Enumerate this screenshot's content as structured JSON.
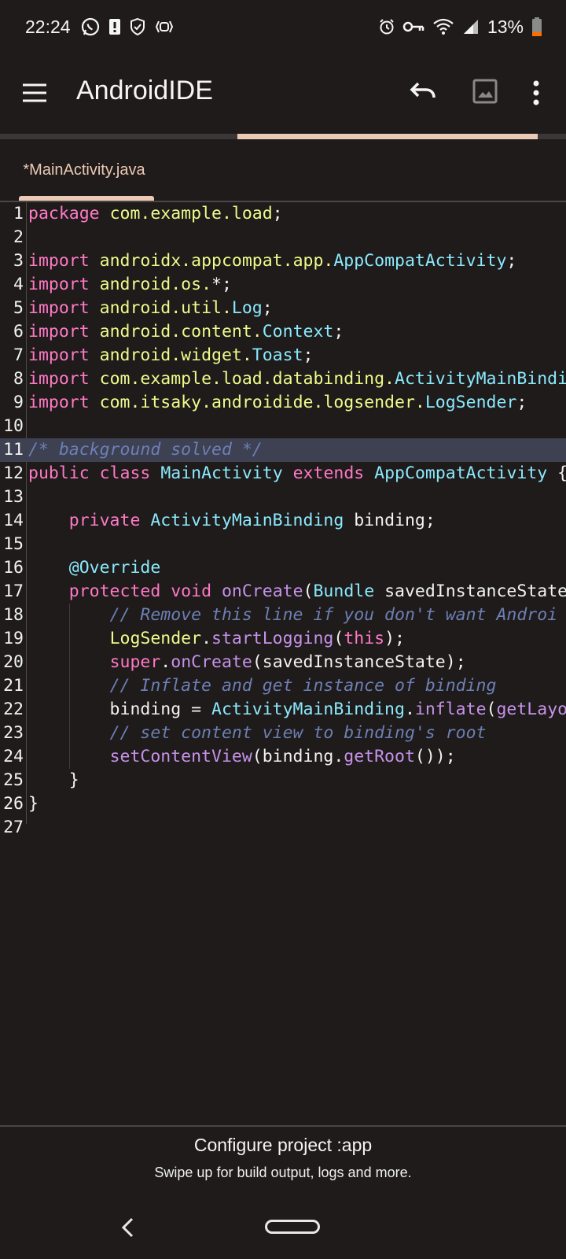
{
  "status": {
    "time": "22:24",
    "battery": "13%",
    "left_icons": [
      "whatsapp-icon",
      "alert-icon",
      "shield-icon",
      "debug-icon"
    ],
    "right_icons": [
      "alarm-icon",
      "vpn-key-icon",
      "wifi-icon",
      "signal-icon",
      "battery-icon"
    ]
  },
  "appbar": {
    "title": "AndroidIDE",
    "icons": [
      "menu-icon",
      "undo-icon",
      "image-icon",
      "more-vert-icon"
    ]
  },
  "progress": 0.55,
  "tabs": [
    {
      "label": "*MainActivity.java",
      "active": true
    }
  ],
  "editor": {
    "current_line": 11,
    "lines": [
      {
        "n": "1",
        "tokens": [
          [
            "kw",
            "package"
          ],
          [
            "",
            " "
          ],
          [
            "pk",
            "com.example.load"
          ],
          [
            "",
            ";"
          ]
        ]
      },
      {
        "n": "2",
        "tokens": []
      },
      {
        "n": "3",
        "tokens": [
          [
            "kw",
            "import"
          ],
          [
            "",
            " "
          ],
          [
            "pk",
            "androidx.appcompat.app."
          ],
          [
            "ty",
            "AppCompatActivity"
          ],
          [
            "",
            ";"
          ]
        ]
      },
      {
        "n": "4",
        "tokens": [
          [
            "kw",
            "import"
          ],
          [
            "",
            " "
          ],
          [
            "pk",
            "android.os."
          ],
          [
            "",
            "*;"
          ]
        ]
      },
      {
        "n": "5",
        "tokens": [
          [
            "kw",
            "import"
          ],
          [
            "",
            " "
          ],
          [
            "pk",
            "android.util."
          ],
          [
            "ty",
            "Log"
          ],
          [
            "",
            ";"
          ]
        ]
      },
      {
        "n": "6",
        "tokens": [
          [
            "kw",
            "import"
          ],
          [
            "",
            " "
          ],
          [
            "pk",
            "android.content."
          ],
          [
            "ty",
            "Context"
          ],
          [
            "",
            ";"
          ]
        ]
      },
      {
        "n": "7",
        "tokens": [
          [
            "kw",
            "import"
          ],
          [
            "",
            " "
          ],
          [
            "pk",
            "android.widget."
          ],
          [
            "ty",
            "Toast"
          ],
          [
            "",
            ";"
          ]
        ]
      },
      {
        "n": "8",
        "tokens": [
          [
            "kw",
            "import"
          ],
          [
            "",
            " "
          ],
          [
            "pk",
            "com.example.load.databinding."
          ],
          [
            "ty",
            "ActivityMainBindi"
          ]
        ]
      },
      {
        "n": "9",
        "tokens": [
          [
            "kw",
            "import"
          ],
          [
            "",
            " "
          ],
          [
            "pk",
            "com.itsaky.androidide.logsender."
          ],
          [
            "ty",
            "LogSender"
          ],
          [
            "",
            ";"
          ]
        ]
      },
      {
        "n": "10",
        "tokens": []
      },
      {
        "n": "11",
        "tokens": [
          [
            "cm",
            "/* background solved */"
          ]
        ]
      },
      {
        "n": "12",
        "tokens": [
          [
            "kw",
            "public"
          ],
          [
            "",
            " "
          ],
          [
            "kw",
            "class"
          ],
          [
            "",
            " "
          ],
          [
            "ty",
            "MainActivity"
          ],
          [
            "",
            " "
          ],
          [
            "kw",
            "extends"
          ],
          [
            "",
            " "
          ],
          [
            "ty",
            "AppCompatActivity"
          ],
          [
            "",
            " {"
          ]
        ]
      },
      {
        "n": "13",
        "tokens": []
      },
      {
        "n": "14",
        "tokens": [
          [
            "",
            "    "
          ],
          [
            "kw",
            "private"
          ],
          [
            "",
            " "
          ],
          [
            "ty",
            "ActivityMainBinding"
          ],
          [
            "",
            " binding;"
          ]
        ]
      },
      {
        "n": "15",
        "tokens": []
      },
      {
        "n": "16",
        "tokens": [
          [
            "",
            "    "
          ],
          [
            "ty",
            "@Override"
          ]
        ]
      },
      {
        "n": "17",
        "tokens": [
          [
            "",
            "    "
          ],
          [
            "kw",
            "protected"
          ],
          [
            "",
            " "
          ],
          [
            "kw",
            "void"
          ],
          [
            "",
            " "
          ],
          [
            "fn",
            "onCreate"
          ],
          [
            "",
            "("
          ],
          [
            "ty",
            "Bundle"
          ],
          [
            "",
            " savedInstanceState"
          ]
        ]
      },
      {
        "n": "18",
        "tokens": [
          [
            "",
            "        "
          ],
          [
            "cm",
            "// Remove this line if you don't want Androi"
          ]
        ]
      },
      {
        "n": "19",
        "tokens": [
          [
            "",
            "        "
          ],
          [
            "pk",
            "LogSender"
          ],
          [
            "",
            "."
          ],
          [
            "fn",
            "startLogging"
          ],
          [
            "",
            "("
          ],
          [
            "kw",
            "this"
          ],
          [
            "",
            ");"
          ]
        ]
      },
      {
        "n": "20",
        "tokens": [
          [
            "",
            "        "
          ],
          [
            "kw",
            "super"
          ],
          [
            "",
            "."
          ],
          [
            "fn",
            "onCreate"
          ],
          [
            "",
            "(savedInstanceState);"
          ]
        ]
      },
      {
        "n": "21",
        "tokens": [
          [
            "",
            "        "
          ],
          [
            "cm",
            "// Inflate and get instance of binding"
          ]
        ]
      },
      {
        "n": "22",
        "tokens": [
          [
            "",
            "        binding = "
          ],
          [
            "ty",
            "ActivityMainBinding"
          ],
          [
            "",
            "."
          ],
          [
            "fn",
            "inflate"
          ],
          [
            "",
            "("
          ],
          [
            "fn",
            "getLayo"
          ]
        ]
      },
      {
        "n": "23",
        "tokens": [
          [
            "",
            "        "
          ],
          [
            "cm",
            "// set content view to binding's root"
          ]
        ]
      },
      {
        "n": "24",
        "tokens": [
          [
            "",
            "        "
          ],
          [
            "fn",
            "setContentView"
          ],
          [
            "",
            "(binding."
          ],
          [
            "fn",
            "getRoot"
          ],
          [
            "",
            "());"
          ]
        ]
      },
      {
        "n": "25",
        "tokens": [
          [
            "",
            "    }"
          ]
        ]
      },
      {
        "n": "26",
        "tokens": [
          [
            "",
            "}"
          ]
        ]
      },
      {
        "n": "27",
        "tokens": []
      }
    ]
  },
  "bottom": {
    "title": "Configure project :app",
    "hint": "Swipe up for build output, logs and more."
  },
  "nav": {
    "icons": [
      "back-icon",
      "home-icon"
    ]
  }
}
